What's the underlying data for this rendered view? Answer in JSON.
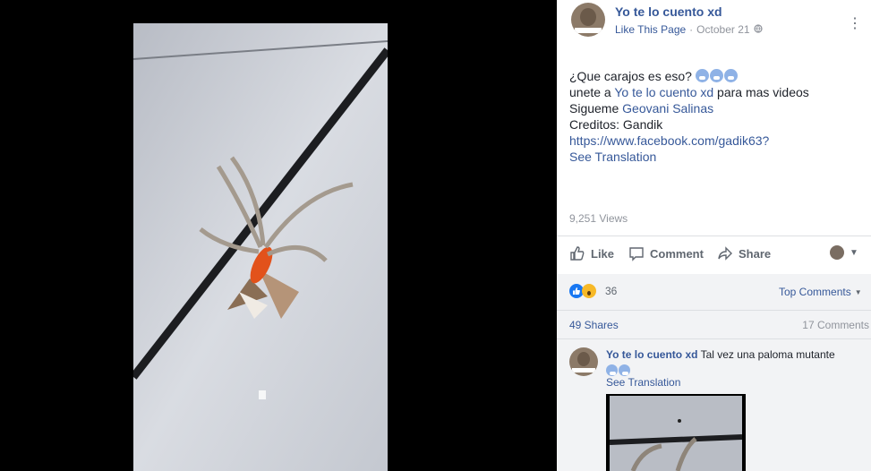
{
  "page": {
    "name": "Yo te lo cuento xd",
    "like_link": "Like This Page",
    "date": "October 21"
  },
  "post": {
    "line1": "¿Que carajos es eso?",
    "line2_pre": "unete a ",
    "line2_link": "Yo te lo cuento xd",
    "line2_post": " para mas videos",
    "line3_pre": "Sigueme ",
    "line3_link": "Geovani Salinas",
    "line4": "Creditos: Gandik",
    "url": "https://www.facebook.com/gadik63?",
    "see_translation": "See Translation"
  },
  "views": "9,251 Views",
  "actions": {
    "like": "Like",
    "comment": "Comment",
    "share": "Share"
  },
  "reactions": {
    "count": "36",
    "top_comments": "Top Comments"
  },
  "stats": {
    "shares": "49 Shares",
    "comments": "17 Comments"
  },
  "comment": {
    "author": "Yo te lo cuento xd",
    "text": "Tal vez una paloma mutante",
    "see_translation": "See Translation"
  },
  "colors": {
    "link": "#365899",
    "muted": "#90949c",
    "like_blue": "#1877f2"
  }
}
